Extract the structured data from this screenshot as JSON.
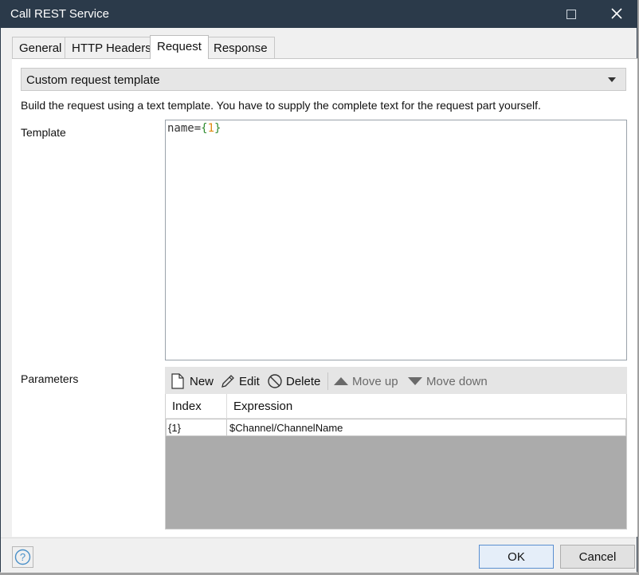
{
  "window": {
    "title": "Call REST Service"
  },
  "tabs": [
    {
      "label": "General"
    },
    {
      "label": "HTTP Headers"
    },
    {
      "label": "Request"
    },
    {
      "label": "Response"
    }
  ],
  "request": {
    "mode_value": "Custom request template",
    "description": "Build the request using a text template. You have to supply the complete text for the request part yourself.",
    "template_label": "Template",
    "template": {
      "name": "name=",
      "open": "{",
      "num": "1",
      "close": "}"
    },
    "parameters_label": "Parameters",
    "toolbar": {
      "new": "New",
      "edit": "Edit",
      "delete": "Delete",
      "move_up": "Move up",
      "move_down": "Move down"
    },
    "columns": {
      "index": "Index",
      "expression": "Expression"
    },
    "rows": [
      {
        "index": "{1}",
        "expression": "$Channel/ChannelName"
      }
    ]
  },
  "footer": {
    "ok": "OK",
    "cancel": "Cancel"
  },
  "colors": {
    "titlebar": "#2b3a4a",
    "template_brace": "#2e8b2e",
    "template_number": "#e08a10",
    "ok_border": "#5a8fd0"
  }
}
